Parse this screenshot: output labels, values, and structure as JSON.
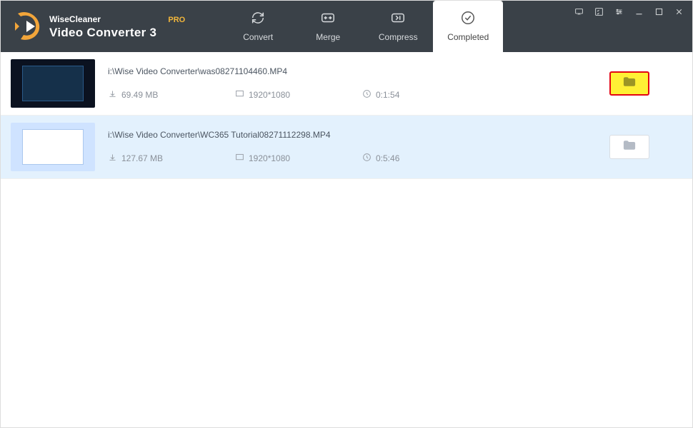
{
  "brand": {
    "line1": "WiseCleaner",
    "pro": "PRO",
    "line2": "Video Converter 3"
  },
  "tabs": {
    "convert": "Convert",
    "merge": "Merge",
    "compress": "Compress",
    "completed": "Completed"
  },
  "items": [
    {
      "path": "i:\\Wise Video Converter\\was08271104460.MP4",
      "size": "69.49 MB",
      "resolution": "1920*1080",
      "duration": "0:1:54"
    },
    {
      "path": "i:\\Wise Video Converter\\WC365 Tutorial08271112298.MP4",
      "size": "127.67 MB",
      "resolution": "1920*1080",
      "duration": "0:5:46"
    }
  ]
}
